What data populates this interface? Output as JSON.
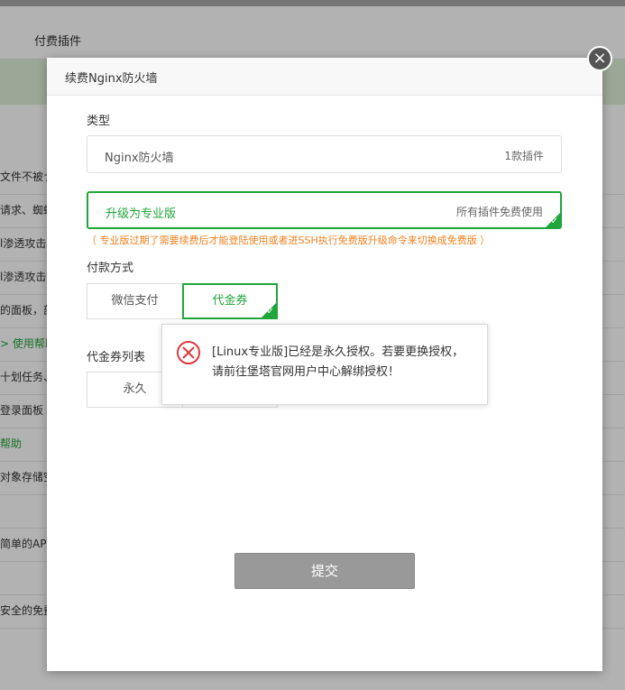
{
  "background": {
    "header_tab": "付费插件",
    "rows": [
      {
        "text": "文件不被ナ"
      },
      {
        "text": "请求、蜘蛛"
      },
      {
        "text": "l渗透攻击"
      },
      {
        "text": "l渗透攻击"
      },
      {
        "text": "的面板，部"
      },
      {
        "text": "> 使用帮助",
        "green": true
      },
      {
        "text": "十划任务、"
      },
      {
        "text": "登录面板（"
      },
      {
        "text": "帮助",
        "green": true
      },
      {
        "text": "对象存储空"
      },
      {
        "text": ""
      },
      {
        "text": "简单的API"
      },
      {
        "text": ""
      },
      {
        "text": "安全的免费"
      }
    ]
  },
  "modal": {
    "title": "续费Nginx防火墙",
    "close_glyph": "×",
    "type_label": "类型",
    "type_option": {
      "name": "Nginx防火墙",
      "count": "1款插件"
    },
    "upgrade_option": {
      "name": "升级为专业版",
      "desc": "所有插件免费使用"
    },
    "warning": "（ 专业版过期了需要续费后才能登陆使用或者进SSH执行免费版升级命令来切换成免费版 ）",
    "payment_label": "付款方式",
    "payment_methods": [
      {
        "label": "微信支付",
        "selected": false
      },
      {
        "label": "代金券",
        "selected": true
      }
    ],
    "coupon_label": "代金券列表",
    "coupons": [
      {
        "label": "永久"
      }
    ],
    "submit_label": "提交"
  },
  "toast": {
    "message": "[Linux专业版]已经是永久授权。若要更换授权，请前往堡塔官网用户中心解绑授权！"
  },
  "colors": {
    "accent": "#20a53a",
    "warning": "#f0811f",
    "error": "#e0393e"
  }
}
